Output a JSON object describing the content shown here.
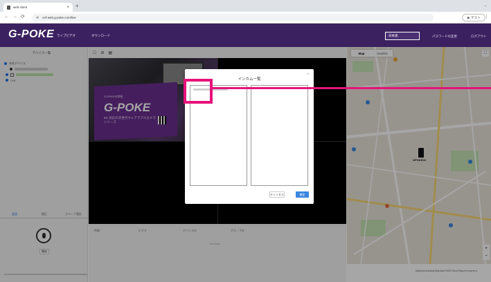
{
  "browser": {
    "tab_title": "web-client",
    "omnibox_url": "ecf-web.g-poke.com/live",
    "profile_label": "ゲスト"
  },
  "header": {
    "logo": "G-POKE",
    "nav": [
      "ライブビデオ",
      "ダウンロード"
    ],
    "select_value": "日本語",
    "links": [
      "パスワードの変更",
      "ログアウト"
    ]
  },
  "left_panel": {
    "title": "デバイス一覧",
    "tree_root": "本社デバイス",
    "tree_item": "CH1",
    "tabs": [
      "会話",
      "通話",
      "グループ通話"
    ],
    "mic_button_label": "開始"
  },
  "video": {
    "footer_labels": [
      "時間",
      "ビデオ",
      "デバイスID",
      "グループ名"
    ],
    "no_data": "No Data",
    "camera_overlay": {
      "logo": "G-POKE",
      "caption": "G-POKEの特長",
      "subtext_line1": "5G 対応の次世代ウェアラブルカメラ",
      "subtext_line2": "シリーズ"
    }
  },
  "map": {
    "type_map": "Map",
    "type_satellite": "Satellite",
    "marker_label": "GPOKE04",
    "footer": "Keyboard shortcuts  Map data ©2023  Terms  Report a map error"
  },
  "modal": {
    "title": "インカムー覧",
    "cancel_label": "キャンセル",
    "ok_label": "確定"
  },
  "colors": {
    "header_bg": "#3b2160",
    "accent_blue": "#3b86e0",
    "highlight": "#e6127a"
  }
}
